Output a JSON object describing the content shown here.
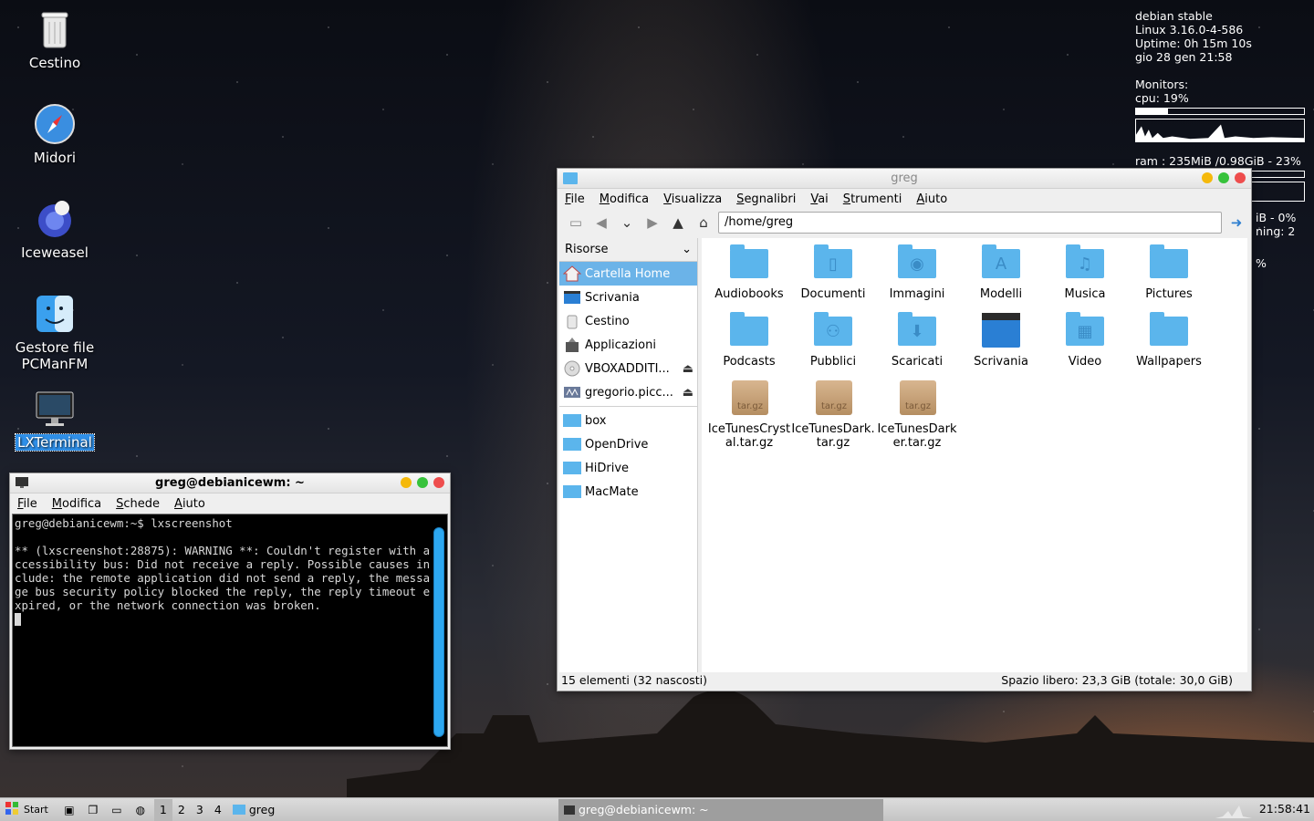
{
  "desktop": {
    "icons": [
      {
        "label": "Cestino"
      },
      {
        "label": "Midori"
      },
      {
        "label": "Iceweasel"
      },
      {
        "label": "Gestore file PCManFM"
      },
      {
        "label": "LXTerminal"
      }
    ]
  },
  "conky": {
    "os": "debian stable",
    "kernel": "Linux 3.16.0-4-586",
    "uptime": "Uptime: 0h 15m 10s",
    "date": "gio 28 gen 21:58",
    "monitors": "Monitors:",
    "cpu": "cpu: 19%",
    "cpu_fraction": 0.19,
    "ram": "ram : 235MiB /0.98GiB - 23%",
    "ram_fraction": 0.23,
    "swap_tail": "iB - 0%",
    "running_tail": "ning: 2",
    "pct_tail": "%"
  },
  "terminal": {
    "title": "greg@debianicewm: ~",
    "menu": [
      "File",
      "Modifica",
      "Schede",
      "Aiuto"
    ],
    "output": "greg@debianicewm:~$ lxscreenshot\n\n** (lxscreenshot:28875): WARNING **: Couldn't register with accessibility bus: Did not receive a reply. Possible causes include: the remote application did not send a reply, the message bus security policy blocked the reply, the reply timeout expired, or the network connection was broken."
  },
  "filemanager": {
    "title": "greg",
    "menu": [
      "File",
      "Modifica",
      "Visualizza",
      "Segnalibri",
      "Vai",
      "Strumenti",
      "Aiuto"
    ],
    "path": "/home/greg",
    "side_header": "Risorse",
    "places": [
      {
        "label": "Cartella Home"
      },
      {
        "label": "Scrivania"
      },
      {
        "label": "Cestino"
      },
      {
        "label": "Applicazioni"
      },
      {
        "label": "VBOXADDITI..."
      },
      {
        "label": "gregorio.picc..."
      }
    ],
    "bookmarks": [
      {
        "label": "box"
      },
      {
        "label": "OpenDrive"
      },
      {
        "label": "HiDrive"
      },
      {
        "label": "MacMate"
      }
    ],
    "files": [
      {
        "label": "Audiobooks"
      },
      {
        "label": "Documenti"
      },
      {
        "label": "Immagini"
      },
      {
        "label": "Modelli"
      },
      {
        "label": "Musica"
      },
      {
        "label": "Pictures"
      },
      {
        "label": "Podcasts"
      },
      {
        "label": "Pubblici"
      },
      {
        "label": "Scaricati"
      },
      {
        "label": "Scrivania"
      },
      {
        "label": "Video"
      },
      {
        "label": "Wallpapers"
      },
      {
        "label": "IceTunesCrystal.tar.gz"
      },
      {
        "label": "IceTunesDark.tar.gz"
      },
      {
        "label": "IceTunesDarker.tar.gz"
      }
    ],
    "tgz_badge": "tar.gz",
    "status_left": "15 elementi (32 nascosti)",
    "status_right": "Spazio libero: 23,3 GiB (totale: 30,0 GiB)"
  },
  "taskbar": {
    "start": "Start",
    "workspaces": [
      "1",
      "2",
      "3",
      "4"
    ],
    "tasks": [
      "greg",
      "greg@debianicewm: ~"
    ],
    "clock": "21:58:41"
  },
  "colors": {
    "accent": "#2f8fe8",
    "folder": "#5bb5ec",
    "close": "#ee4d4d",
    "maximize": "#37c23b",
    "minimize": "#f5b90b"
  }
}
